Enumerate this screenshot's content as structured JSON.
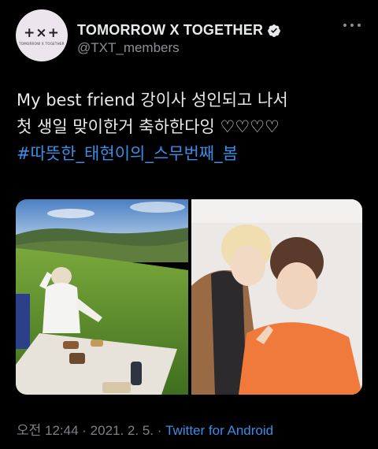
{
  "account": {
    "display_name": "TOMORROW X TOGETHER",
    "handle": "@TXT_members",
    "avatar_logo": "+×+",
    "avatar_sub": "TOMORROW X TOGETHER",
    "verified": true
  },
  "tweet": {
    "text_line1": "My best friend 강이사 성인되고 나서",
    "text_line2": "첫 생일 맞이한거 축하한다잉 ♡♡♡♡",
    "hashtag": "#따뜻한_태현이의_스무번째_봄"
  },
  "media": [
    {
      "description_icon": "photo-icon"
    },
    {
      "description_icon": "photo-icon"
    }
  ],
  "footer": {
    "time": "오전 12:44",
    "separator1": " · ",
    "date": "2021. 2. 5.",
    "separator2": " · ",
    "source": "Twitter for Android"
  },
  "colors": {
    "background": "#000000",
    "text": "#e7e9ea",
    "muted": "#8b8f94",
    "link": "#3a8ee6"
  }
}
